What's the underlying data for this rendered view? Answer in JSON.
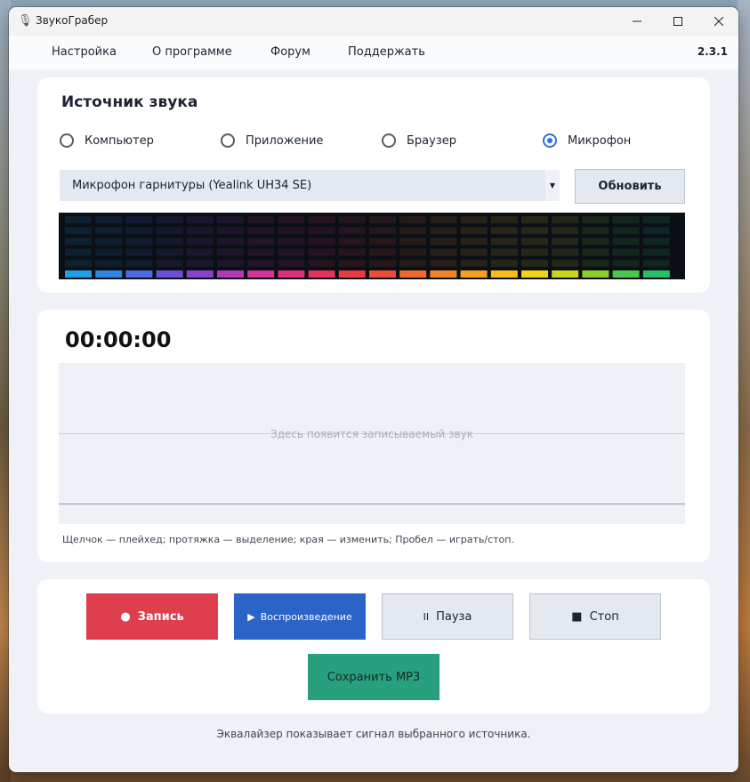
{
  "window": {
    "title": "ЗвукоГрабер",
    "icon": "microphone-icon"
  },
  "menu": {
    "items": [
      "Настройка",
      "О программе",
      "Форум",
      "Поддержать"
    ],
    "version": "2.3.1"
  },
  "source": {
    "title": "Источник звука",
    "options": [
      "Компьютер",
      "Приложение",
      "Браузер",
      "Микрофон"
    ],
    "selected": "Микрофон",
    "device": "Микрофон гарнитуры (Yealink UH34 SE)",
    "refresh_label": "Обновить",
    "eq_colors": [
      "#1ea0e6",
      "#2f86e0",
      "#4a6be0",
      "#6a4fd6",
      "#8a3fcf",
      "#b03ab6",
      "#d4339a",
      "#e02e7e",
      "#e6315e",
      "#ea3a42",
      "#ee4a36",
      "#f0662c",
      "#f28424",
      "#f4a01e",
      "#f6bd1a",
      "#f2d318",
      "#c8d620",
      "#8ccf2c",
      "#4cc64a",
      "#26c06a"
    ]
  },
  "recorder": {
    "time": "00:00:00",
    "placeholder": "Здесь появится записываемый звук",
    "help": "Щелчок — плейхед; протяжка — выделение; края — изменить; Пробел — играть/стоп."
  },
  "controls": {
    "record": "Запись",
    "play": "Воспроизведение",
    "pause": "Пауза",
    "stop": "Стоп",
    "save": "Сохранить MP3",
    "record_color": "#de3e4e",
    "play_color": "#2c63c6",
    "save_color": "#28a07e"
  },
  "footer": "Эквалайзер показывает сигнал выбранного источника."
}
